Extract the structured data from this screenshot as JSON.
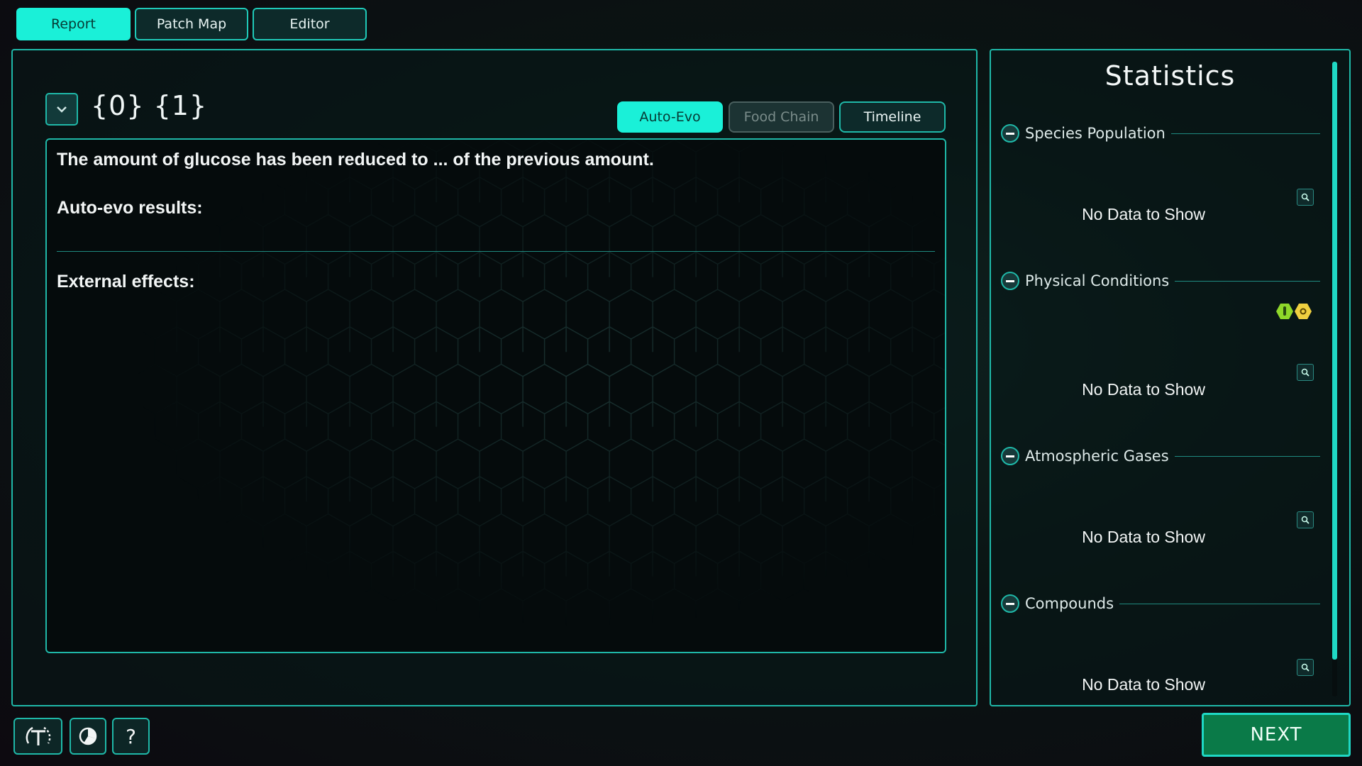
{
  "top_tabs": [
    {
      "label": "Report",
      "active": true
    },
    {
      "label": "Patch Map",
      "active": false
    },
    {
      "label": "Editor",
      "active": false
    }
  ],
  "report": {
    "title": "{0} {1}",
    "sub_tabs": [
      {
        "label": "Auto-Evo",
        "state": "active"
      },
      {
        "label": "Food Chain",
        "state": "disabled"
      },
      {
        "label": "Timeline",
        "state": "normal"
      }
    ],
    "glucose_text": "The amount of glucose has been reduced to ... of the previous amount.",
    "auto_evo_heading": "Auto-evo results:",
    "external_heading": "External effects:"
  },
  "statistics": {
    "title": "Statistics",
    "sections": [
      {
        "label": "Species Population",
        "empty_text": "No Data to Show"
      },
      {
        "label": "Physical Conditions",
        "empty_text": "No Data to Show"
      },
      {
        "label": "Atmospheric Gases",
        "empty_text": "No Data to Show"
      },
      {
        "label": "Compounds",
        "empty_text": "No Data to Show"
      }
    ]
  },
  "bottom_bar": {
    "help_label": "?",
    "next_label": "NEXT"
  },
  "colors": {
    "accent": "#1af0d8",
    "border": "#1fb8a8",
    "next_bg": "#0a7a48"
  },
  "icons": [
    "chevron-down-icon",
    "minus-icon",
    "zoom-icon",
    "temperature-icon",
    "sunlight-icon",
    "tutorial-icon",
    "pie-chart-icon"
  ]
}
